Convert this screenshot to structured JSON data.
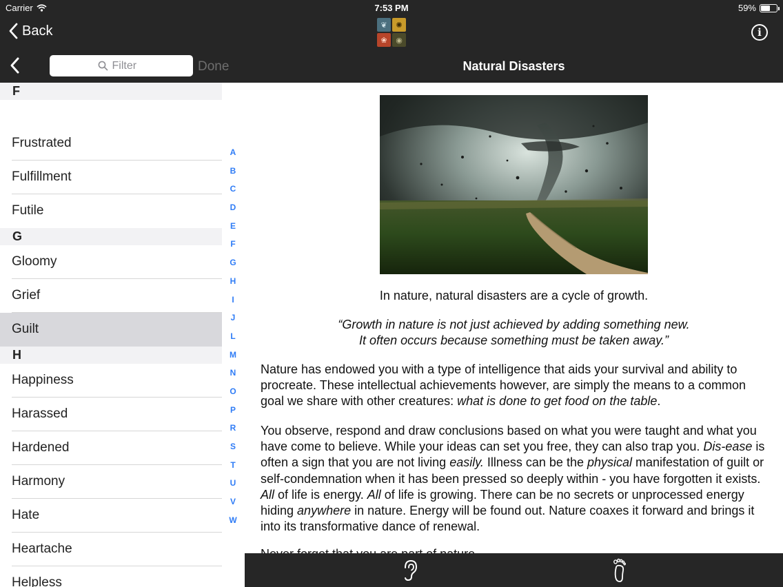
{
  "status": {
    "carrier": "Carrier",
    "time": "7:53 PM",
    "battery": "59%",
    "battery_level": 0.59
  },
  "nav": {
    "back_label": "Back",
    "filter_placeholder": "Filter",
    "done_label": "Done",
    "title": "Natural Disasters"
  },
  "icons": {
    "wifi": "wifi-icon",
    "back": "chevron-left-icon",
    "logo": "app-logo-icon",
    "info": "info-icon",
    "search": "search-icon",
    "ear": "ear-icon",
    "foot": "footprint-icon"
  },
  "logo_glyphs": [
    "❦",
    "✺",
    "❀",
    "◉"
  ],
  "list": {
    "sections": [
      {
        "letter": "F",
        "items": [
          "Frustrated",
          "Fulfillment",
          "Futile"
        ]
      },
      {
        "letter": "G",
        "items": [
          "Gloomy",
          "Grief",
          "Guilt"
        ]
      },
      {
        "letter": "H",
        "items": [
          "Happiness",
          "Harassed",
          "Hardened",
          "Harmony",
          "Hate",
          "Heartache",
          "Helpless"
        ]
      }
    ],
    "selected": "Guilt"
  },
  "index_letters": [
    "A",
    "B",
    "C",
    "D",
    "E",
    "F",
    "G",
    "H",
    "I",
    "J",
    "L",
    "M",
    "N",
    "O",
    "P",
    "R",
    "S",
    "T",
    "U",
    "V",
    "W"
  ],
  "article": {
    "caption": "In nature, natural disasters are a cycle of growth.",
    "quote_line1": "“Growth in nature is not just achieved by adding something new.",
    "quote_line2": "It often occurs because something must be taken away.”",
    "p1_a": "Nature has endowed you with a type of intelligence that aids your survival and ability to procreate. These intellectual achievements however, are simply the means to a common goal we share with other creatures: ",
    "p1_b": "what is done to get food on the table",
    "p1_c": ".",
    "p2_a": "You observe, respond and draw conclusions based on what you were taught and what you have come to believe. While your ideas can set you free, they can also trap you. ",
    "p2_b": "Dis-ease",
    "p2_c": " is often a sign that you are not living ",
    "p2_d": "easily.",
    "p2_e": " Illness can be the ",
    "p2_f": "physical",
    "p2_g": " manifestation of guilt or self-condemnation when it has been pressed so deeply within - you have forgotten it exists. ",
    "p2_h": "All",
    "p2_i": " of life is energy. ",
    "p2_j": "All",
    "p2_k": " of life is growing. There can be no secrets or unprocessed energy hiding ",
    "p2_l": "anywhere",
    "p2_m": " in nature. Energy will be found out. Nature coaxes it forward and brings it into its transformative dance of renewal.",
    "p3": "Never forget that you are part of nature."
  },
  "colors": {
    "chrome": "#262626",
    "index_accent": "#2f7cf6",
    "selected_row": "#d8d8dc",
    "section_header": "#f2f2f4"
  }
}
